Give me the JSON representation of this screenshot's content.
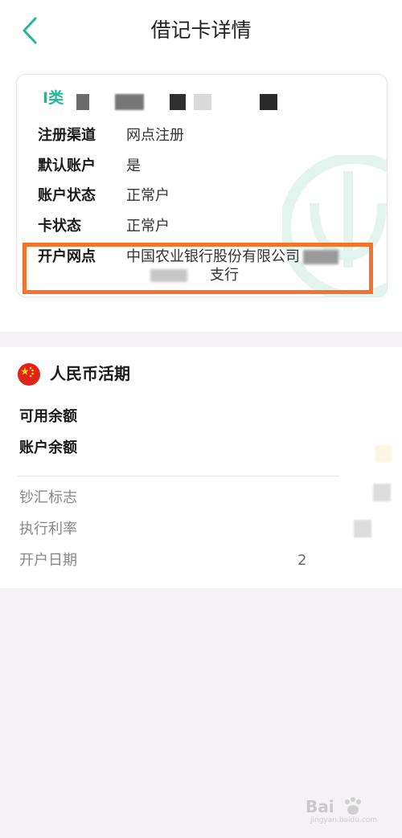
{
  "header": {
    "title": "借记卡详情"
  },
  "card": {
    "type_label": "I类",
    "rows": [
      {
        "label": "注册渠道",
        "value": "网点注册"
      },
      {
        "label": "默认账户",
        "value": "是"
      },
      {
        "label": "账户状态",
        "value": "正常户"
      },
      {
        "label": "卡状态",
        "value": "正常户"
      },
      {
        "label": "开户网点",
        "value": "中国农业银行股份有限公司",
        "value_line2": "支行"
      }
    ]
  },
  "currency": {
    "title": "人民币活期",
    "balances": [
      {
        "label": "可用余额"
      },
      {
        "label": "账户余额"
      }
    ],
    "info": [
      {
        "label": "钞汇标志"
      },
      {
        "label": "执行利率"
      },
      {
        "label": "开户日期",
        "value": "2"
      }
    ]
  },
  "watermark": {
    "brand": "Bai",
    "site": "jingyan.baidu.com"
  },
  "colors": {
    "accent": "#27b59a",
    "highlight": "#f5722a",
    "flag": "#e2231a"
  }
}
